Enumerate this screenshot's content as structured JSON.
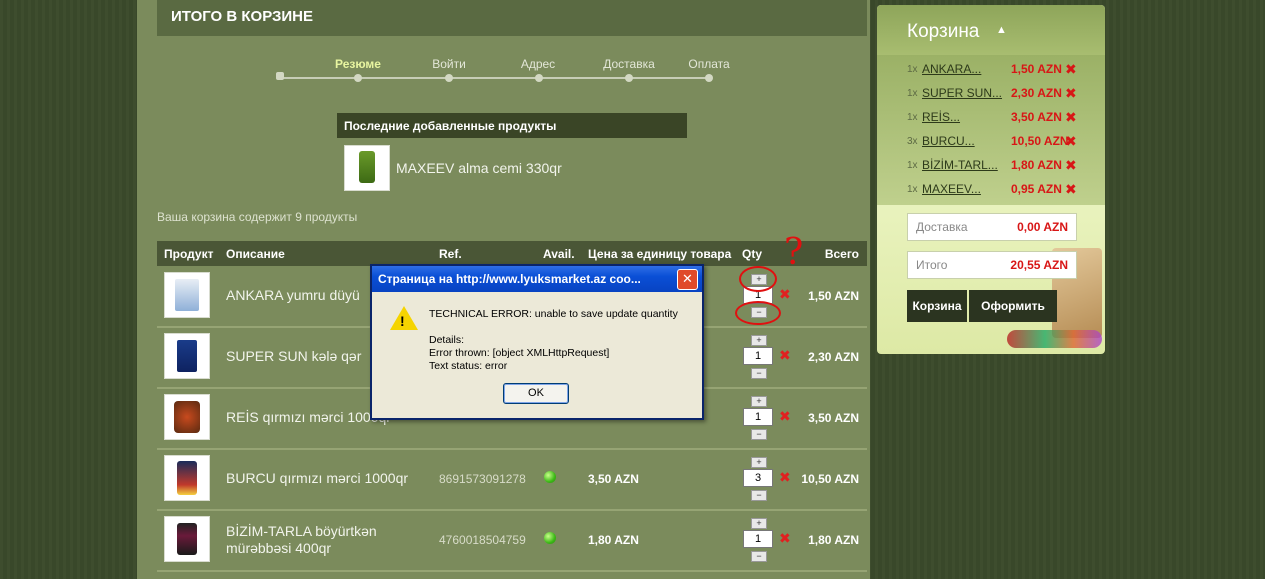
{
  "header": {
    "title": "ИТОГО В КОРЗИНЕ"
  },
  "steps": [
    {
      "label": "Резюме",
      "active": true
    },
    {
      "label": "Войти",
      "active": false
    },
    {
      "label": "Адрес",
      "active": false
    },
    {
      "label": "Доставка",
      "active": false
    },
    {
      "label": "Оплата",
      "active": false
    }
  ],
  "recent": {
    "title": "Последние добавленные продукты",
    "product": "MAXEEV alma cemi 330qr"
  },
  "cart_count_text": "Ваша корзина содержит 9 продукты",
  "table": {
    "headers": {
      "product": "Продукт",
      "description": "Описание",
      "ref": "Ref.",
      "avail": "Avail.",
      "unit_price": "Цена за единицу товара",
      "qty": "Qty",
      "total": "Всего"
    },
    "rows": [
      {
        "description": "ANKARA yumru düyü",
        "ref": "",
        "price": "",
        "qty": "1",
        "total": "1,50 AZN"
      },
      {
        "description": "SUPER SUN kələ qər",
        "ref": "",
        "price": "",
        "qty": "1",
        "total": "2,30 AZN"
      },
      {
        "description": "REİS qırmızı mərci 1000qr",
        "ref": "",
        "price": "",
        "qty": "1",
        "total": "3,50 AZN"
      },
      {
        "description": "BURCU qırmızı mərci 1000qr",
        "ref": "8691573091278",
        "price": "3,50 AZN",
        "qty": "3",
        "total": "10,50 AZN"
      },
      {
        "description": "BİZİM-TARLA böyürtkən mürəbbəsi 400qr",
        "ref": "4760018504759",
        "price": "1,80 AZN",
        "qty": "1",
        "total": "1,80 AZN"
      }
    ],
    "plus": "+",
    "minus": "−"
  },
  "side_cart": {
    "title": "Корзина",
    "items": [
      {
        "qty": "1x",
        "name": "ANKARA...",
        "price": "1,50 AZN"
      },
      {
        "qty": "1x",
        "name": "SUPER SUN...",
        "price": "2,30 AZN"
      },
      {
        "qty": "1x",
        "name": "REİS...",
        "price": "3,50 AZN"
      },
      {
        "qty": "3x",
        "name": "BURCU...",
        "price": "10,50 AZN"
      },
      {
        "qty": "1x",
        "name": "BİZİM-TARL...",
        "price": "1,80 AZN"
      },
      {
        "qty": "1x",
        "name": "MAXEEV...",
        "price": "0,95 AZN"
      }
    ],
    "shipping_label": "Доставка",
    "shipping_value": "0,00 AZN",
    "total_label": "Итого",
    "total_value": "20,55 AZN",
    "cart_button": "Корзина",
    "checkout_button": "Оформить"
  },
  "dialog": {
    "title": "Страница на http://www.lyuksmarket.az coo...",
    "close": "✕",
    "line1": "TECHNICAL ERROR: unable to save update quantity",
    "line2": "Details:",
    "line3": "Error thrown: [object XMLHttpRequest]",
    "line4": "Text status: error",
    "ok": "OK"
  },
  "annotation": {
    "mark": "?"
  },
  "colors": {
    "accent_red": "#d81616",
    "dialog_blue": "#0a4fd6",
    "avail_green": "#3cb816"
  }
}
